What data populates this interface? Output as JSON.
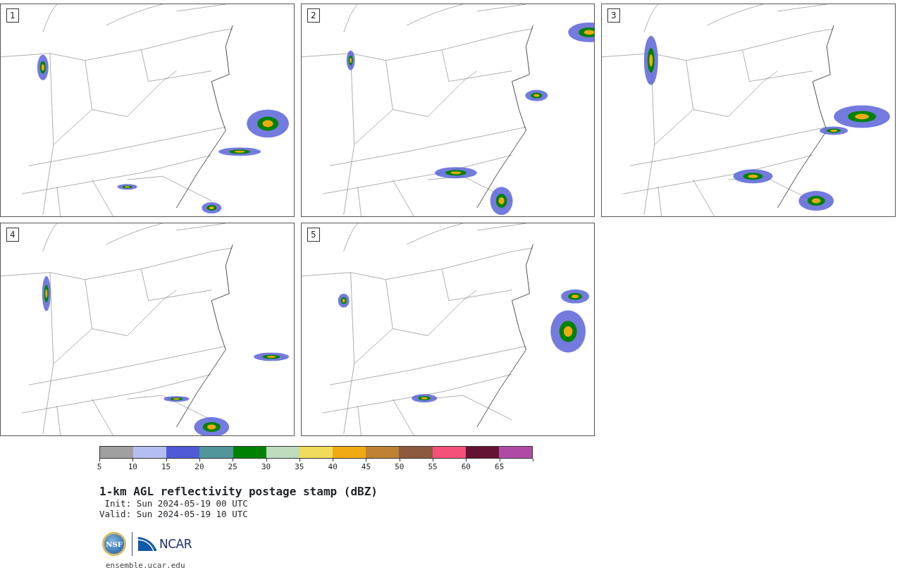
{
  "panels": [
    {
      "label": "1"
    },
    {
      "label": "2"
    },
    {
      "label": "3"
    },
    {
      "label": "4"
    },
    {
      "label": "5"
    }
  ],
  "colorbar": {
    "bins": [
      {
        "color": "#a0a0a0"
      },
      {
        "color": "#b4bef0"
      },
      {
        "color": "#505ad7"
      },
      {
        "color": "#50969b"
      },
      {
        "color": "#008200"
      },
      {
        "color": "#bedcbe"
      },
      {
        "color": "#f0dc5a"
      },
      {
        "color": "#f0aa14"
      },
      {
        "color": "#be8232"
      },
      {
        "color": "#8c5a3c"
      },
      {
        "color": "#f55078"
      },
      {
        "color": "#641432"
      },
      {
        "color": "#af4ba5"
      }
    ],
    "ticks": [
      "5",
      "10",
      "15",
      "20",
      "25",
      "30",
      "35",
      "40",
      "45",
      "50",
      "55",
      "60",
      "65"
    ]
  },
  "title": "1-km AGL reflectivity postage stamp (dBZ)",
  "init": " Init: Sun 2024-05-19 00 UTC",
  "valid": "Valid: Sun 2024-05-19 10 UTC",
  "logos": {
    "nsf": "NSF",
    "ncar": "NCAR"
  },
  "url": "ensemble.ucar.edu"
}
